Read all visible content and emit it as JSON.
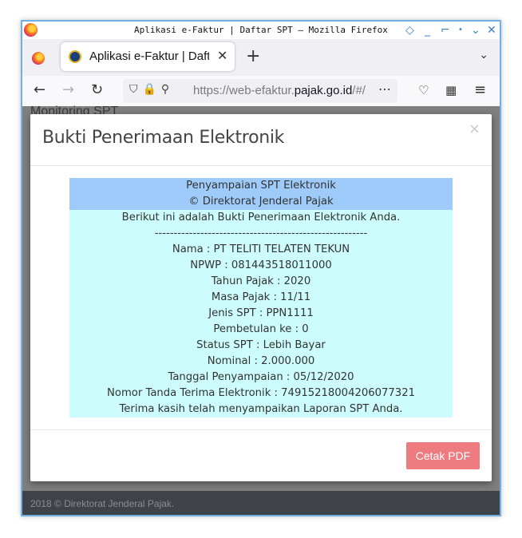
{
  "window": {
    "title": "Aplikasi e-Faktur | Daftar SPT — Mozilla Firefox"
  },
  "tabs": [
    {
      "title": "Aplikasi e-Faktur | Daftar SPT"
    }
  ],
  "address_bar": {
    "url_prefix": "https://web-efaktur.",
    "url_domain": "pajak.go.id",
    "url_suffix": "/#/"
  },
  "page": {
    "heading": "Monitoring SPT",
    "footer": "2018 © Direktorat Jenderal Pajak."
  },
  "modal": {
    "title": "Bukti Penerimaan Elektronik",
    "close_label": "×",
    "header_lines": [
      "Penyampaian SPT Elektronik",
      "© Direktorat Jenderal Pajak"
    ],
    "body_lines": [
      "Berikut ini adalah Bukti Penerimaan Elektronik Anda.",
      "--------------------------------------------------------",
      "Nama : PT TELITI TELATEN TEKUN",
      "NPWP : 081443518011000",
      "Tahun Pajak : 2020",
      "Masa Pajak : 11/11",
      "Jenis SPT : PPN1111",
      "Pembetulan ke : 0",
      "Status SPT : Lebih Bayar",
      "Nominal : 2.000.000",
      "Tanggal Penyampaian : 05/12/2020",
      "Nomor Tanda Terima Elektronik : 74915218004206077321",
      "Terima kasih telah menyampaikan Laporan SPT Anda."
    ],
    "button_label": "Cetak PDF"
  },
  "colors": {
    "receipt_header": "#9fcbfa",
    "receipt_body": "#ccfcfc",
    "button": "#ed7b80",
    "footer": "#3f4347"
  }
}
